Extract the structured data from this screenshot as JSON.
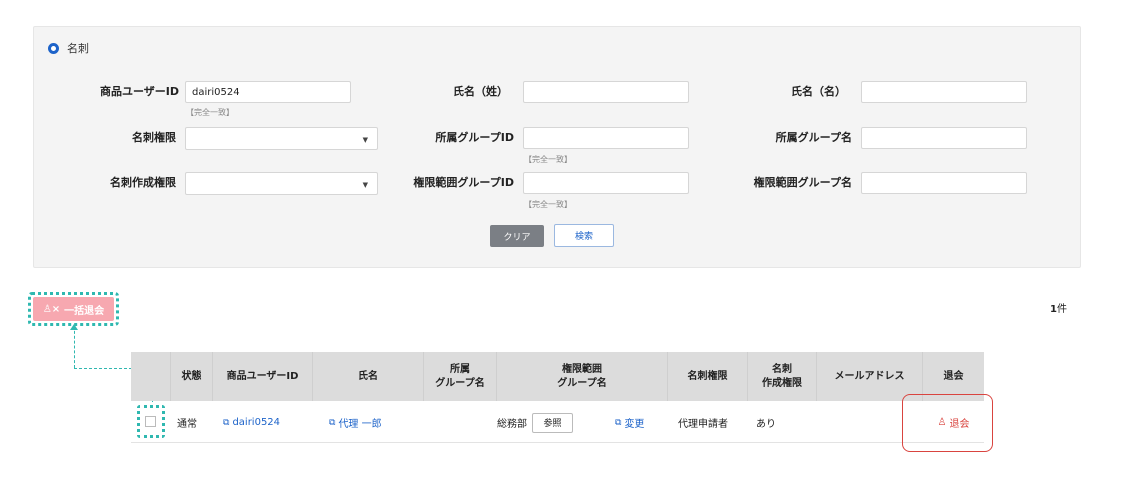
{
  "search_panel": {
    "title": "名刺",
    "fields": {
      "product_user_id": {
        "label": "商品ユーザーID",
        "value": "dairi0524",
        "note": "【完全一致】"
      },
      "last_name": {
        "label": "氏名（姓）",
        "value": ""
      },
      "first_name": {
        "label": "氏名（名）",
        "value": ""
      },
      "card_permission": {
        "label": "名刺権限",
        "value": ""
      },
      "group_id": {
        "label": "所属グループID",
        "value": "",
        "note": "【完全一致】"
      },
      "group_name": {
        "label": "所属グループ名",
        "value": ""
      },
      "card_create_permission": {
        "label": "名刺作成権限",
        "value": ""
      },
      "scope_group_id": {
        "label": "権限範囲グループID",
        "value": "",
        "note": "【完全一致】"
      },
      "scope_group_name": {
        "label": "権限範囲グループ名",
        "value": ""
      }
    },
    "clear_label": "クリア",
    "search_label": "検索"
  },
  "bulk_withdraw_label": "一括退会",
  "count": {
    "number": "1",
    "unit": "件"
  },
  "table": {
    "headers": {
      "status": "状態",
      "user_id": "商品ユーザーID",
      "name": "氏名",
      "group_line1": "所属",
      "group_line2": "グループ名",
      "scope_line1": "権限範囲",
      "scope_line2": "グループ名",
      "card_permission": "名刺権限",
      "create_line1": "名刺",
      "create_line2": "作成権限",
      "email": "メールアドレス",
      "withdraw": "退会"
    },
    "rows": [
      {
        "status": "通常",
        "user_id": "dairi0524",
        "name": "代理 一郎",
        "group": "",
        "scope_group": "総務部",
        "ref_label": "参照",
        "change_label": "変更",
        "card_permission": "代理申請者",
        "create_permission": "あり",
        "email": "",
        "withdraw_label": "退会"
      }
    ]
  },
  "colors": {
    "accent": "#1d63c9",
    "danger": "#d9443f",
    "highlight": "#2fb8b0",
    "bulk_button": "#f7a8b0"
  }
}
